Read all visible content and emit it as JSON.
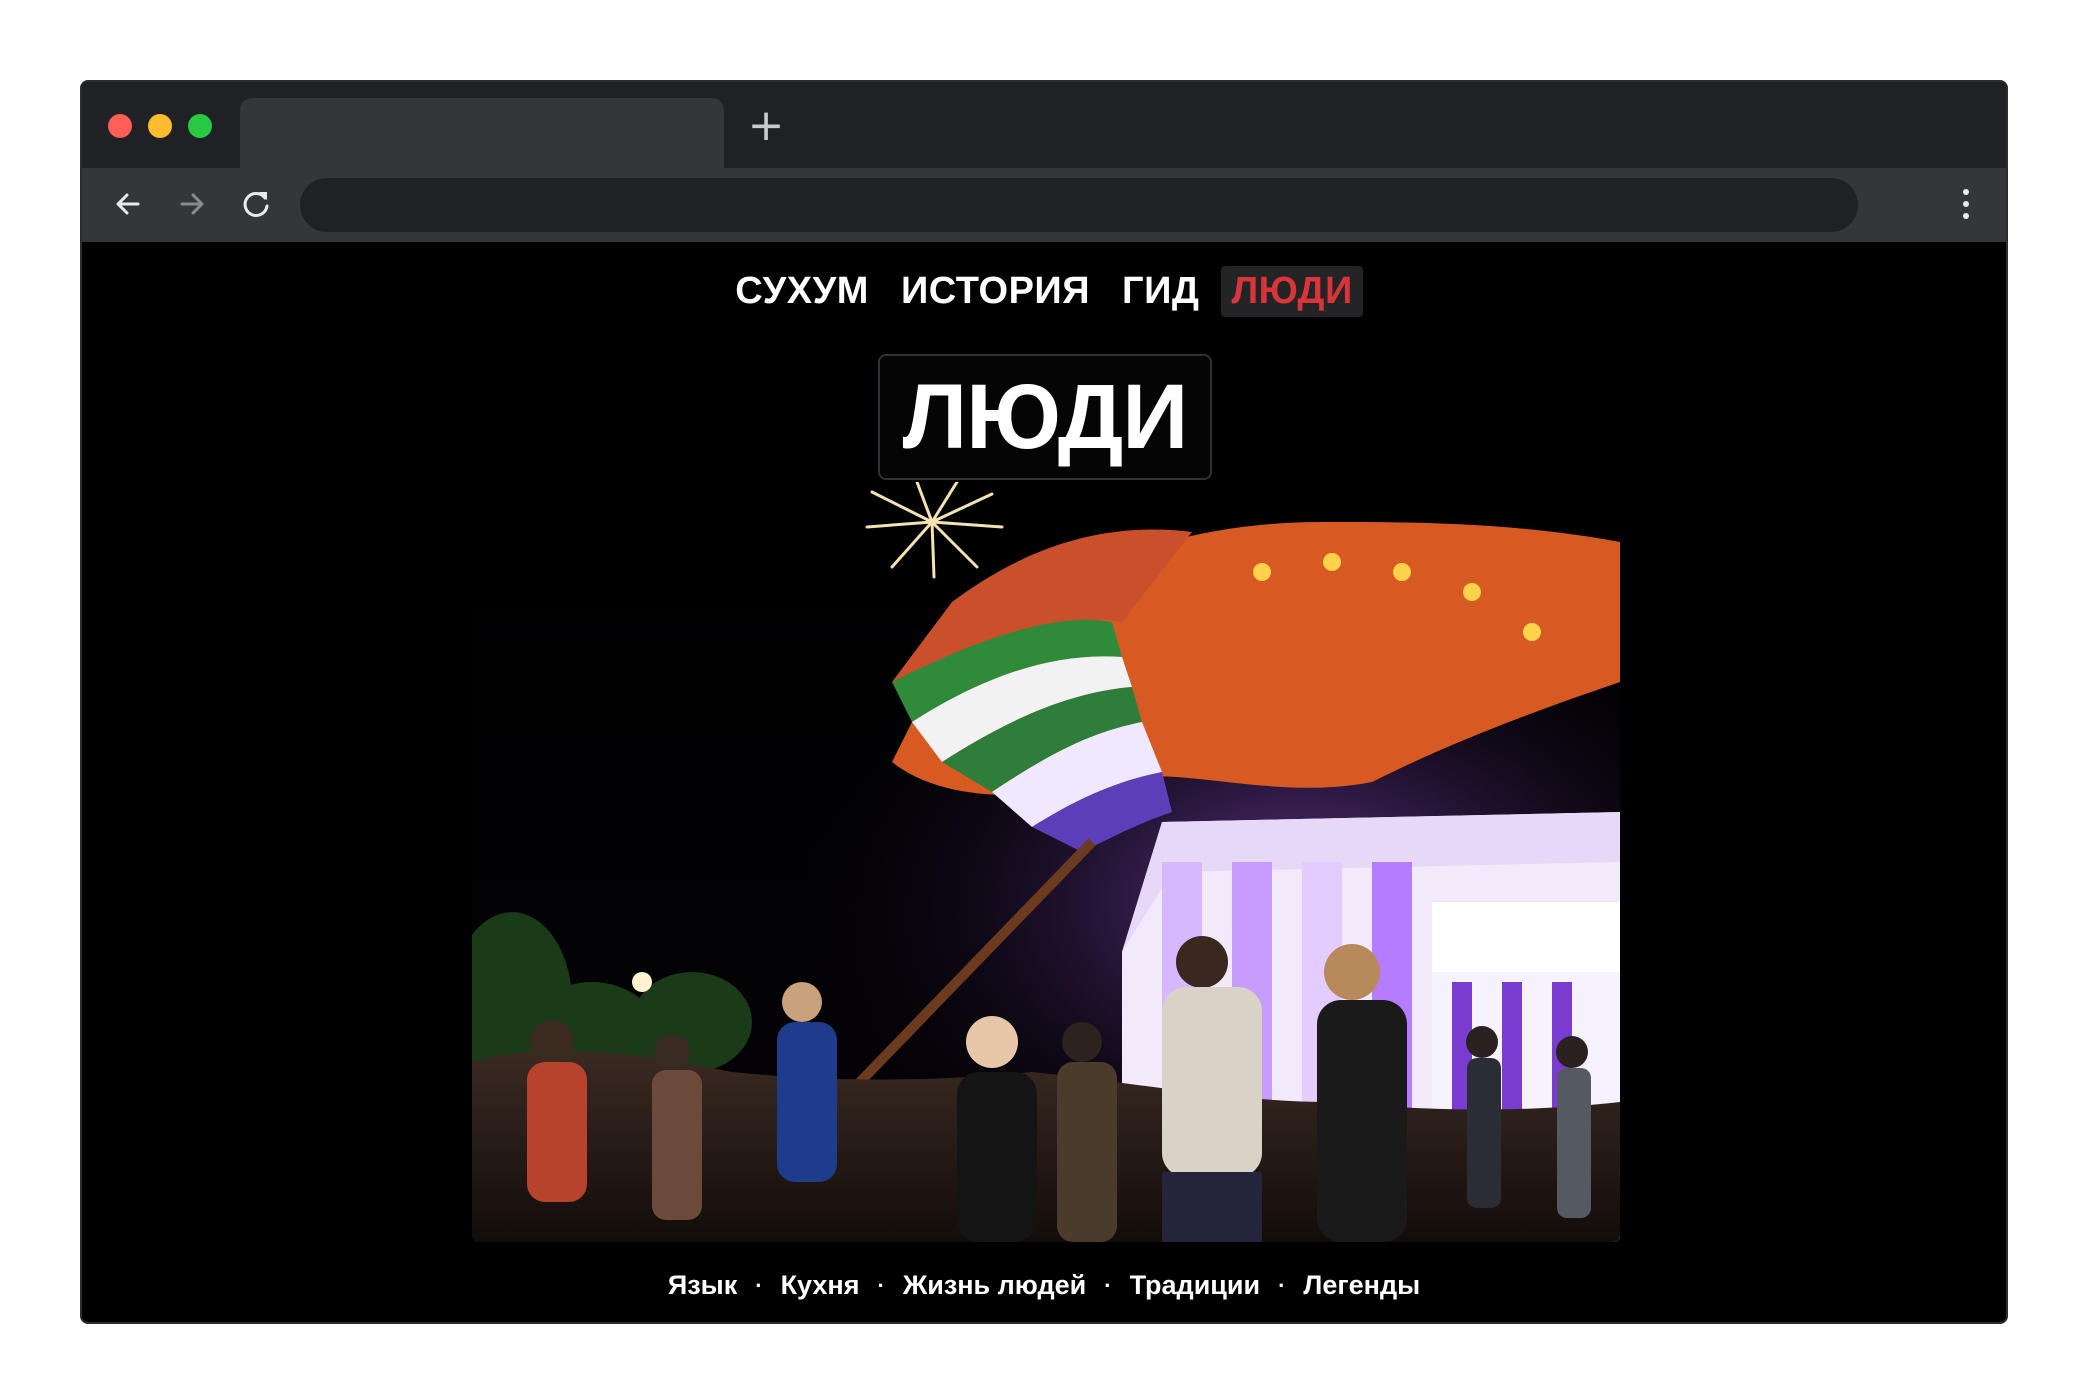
{
  "browser": {
    "tab_title": "",
    "new_tab_label": "+",
    "url": ""
  },
  "site": {
    "nav": [
      {
        "label": "СУХУМ",
        "active": false
      },
      {
        "label": "ИСТОРИЯ",
        "active": false
      },
      {
        "label": "ГИД",
        "active": false
      },
      {
        "label": "ЛЮДИ",
        "active": true
      }
    ],
    "hero_title": "ЛЮДИ",
    "sections": [
      "Язык",
      "Кухня",
      "Жизнь людей",
      "Традиции",
      "Легенды"
    ],
    "separator": "·"
  },
  "colors": {
    "active_nav": "#d8343a",
    "page_background": "#000000",
    "chrome_dark": "#202124",
    "chrome_light": "#35363a"
  },
  "icons": {
    "back": "arrow-left-icon",
    "forward": "arrow-right-icon",
    "reload": "reload-icon",
    "menu": "kebab-menu-icon"
  }
}
